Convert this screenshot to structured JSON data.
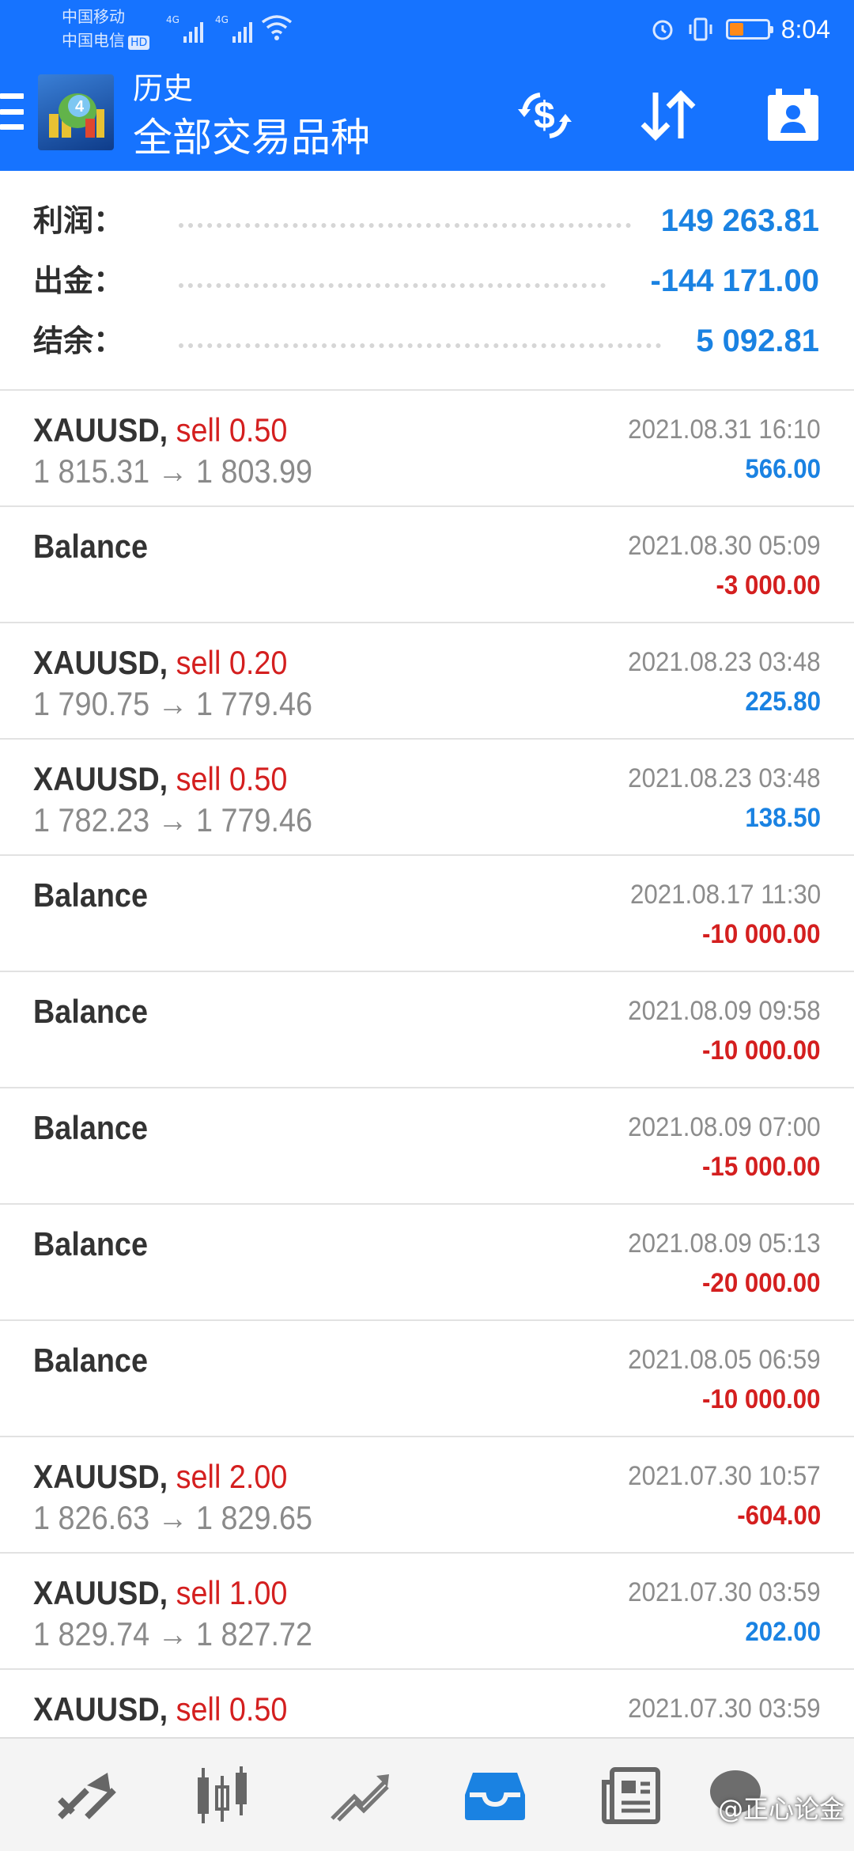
{
  "status_bar": {
    "carrier1": "中国移动",
    "carrier2": "中国电信",
    "hd_badge": "HD",
    "network1": "4G",
    "network2": "4G",
    "time": "8:04"
  },
  "header": {
    "title": "历史",
    "subtitle": "全部交易品种",
    "logo_digit": "4",
    "icons": [
      "menu-icon",
      "currency-exchange-icon",
      "sort-icon",
      "account-icon"
    ],
    "background_color": "#1673ff"
  },
  "summary": [
    {
      "label": "利润：",
      "value": "149 263.81"
    },
    {
      "label": "出金：",
      "value": "-144 171.00"
    },
    {
      "label": "结余：",
      "value": "5 092.81"
    }
  ],
  "deals": [
    {
      "symbol": "XAUUSD,",
      "side": "sell 0.50",
      "prices": "1 815.31 → 1 803.99",
      "time": "2021.08.31 16:10",
      "profit": "566.00",
      "positive": true
    },
    {
      "symbol": "Balance",
      "side": "",
      "prices": "",
      "time": "2021.08.30 05:09",
      "profit": "-3 000.00",
      "positive": false
    },
    {
      "symbol": "XAUUSD,",
      "side": "sell 0.20",
      "prices": "1 790.75 → 1 779.46",
      "time": "2021.08.23 03:48",
      "profit": "225.80",
      "positive": true
    },
    {
      "symbol": "XAUUSD,",
      "side": "sell 0.50",
      "prices": "1 782.23 → 1 779.46",
      "time": "2021.08.23 03:48",
      "profit": "138.50",
      "positive": true
    },
    {
      "symbol": "Balance",
      "side": "",
      "prices": "",
      "time": "2021.08.17 11:30",
      "profit": "-10 000.00",
      "positive": false
    },
    {
      "symbol": "Balance",
      "side": "",
      "prices": "",
      "time": "2021.08.09 09:58",
      "profit": "-10 000.00",
      "positive": false
    },
    {
      "symbol": "Balance",
      "side": "",
      "prices": "",
      "time": "2021.08.09 07:00",
      "profit": "-15 000.00",
      "positive": false
    },
    {
      "symbol": "Balance",
      "side": "",
      "prices": "",
      "time": "2021.08.09 05:13",
      "profit": "-20 000.00",
      "positive": false
    },
    {
      "symbol": "Balance",
      "side": "",
      "prices": "",
      "time": "2021.08.05 06:59",
      "profit": "-10 000.00",
      "positive": false
    },
    {
      "symbol": "XAUUSD,",
      "side": "sell 2.00",
      "prices": "1 826.63 → 1 829.65",
      "time": "2021.07.30 10:57",
      "profit": "-604.00",
      "positive": false
    },
    {
      "symbol": "XAUUSD,",
      "side": "sell 1.00",
      "prices": "1 829.74 → 1 827.72",
      "time": "2021.07.30 03:59",
      "profit": "202.00",
      "positive": true
    },
    {
      "symbol": "XAUUSD,",
      "side": "sell 0.50",
      "prices": "",
      "time": "2021.07.30 03:59",
      "profit": "",
      "positive": true
    }
  ],
  "bottom_nav": {
    "items": [
      "quotes-icon",
      "chart-icon",
      "trade-icon",
      "history-icon",
      "news-icon"
    ],
    "active": "history-icon",
    "watermark": "@正心论金"
  }
}
